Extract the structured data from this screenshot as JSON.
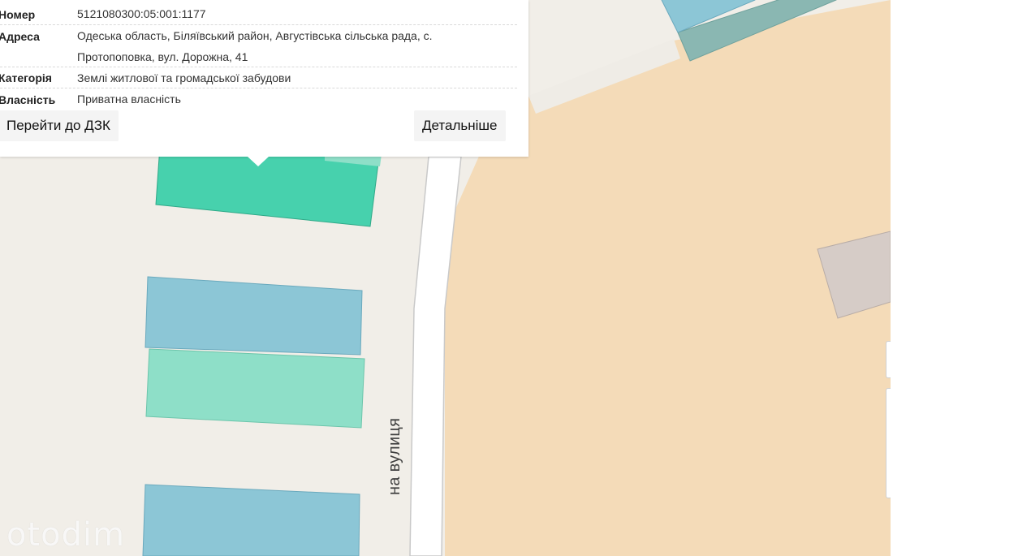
{
  "popup": {
    "rows": [
      {
        "label": "Номер",
        "value": "5121080300:05:001:1177"
      },
      {
        "label": "Адреса",
        "value": "Одеська область, Біляївський район, Августівська сільська рада, с. Протопоповка, вул. Дорожна, 41"
      },
      {
        "label": "Категорія",
        "value": "Землі житлової та громадської забудови"
      },
      {
        "label": "Власність",
        "value": "Приватна власність"
      }
    ],
    "buttons": {
      "goto_label": "Перейти до ДЗК",
      "details_label": "Детальніше"
    }
  },
  "map": {
    "road_label": "на вулиця",
    "colors": {
      "background": "#f1eee8",
      "residential_parcel": "#47d1ad",
      "residential_parcel_light": "#8edfc8",
      "blue_parcel": "#8cc6d6",
      "agricultural": "#f4dbb8",
      "gray_parcel": "#d6ccc7",
      "road": "#ffffff"
    }
  },
  "watermark": "otodim"
}
